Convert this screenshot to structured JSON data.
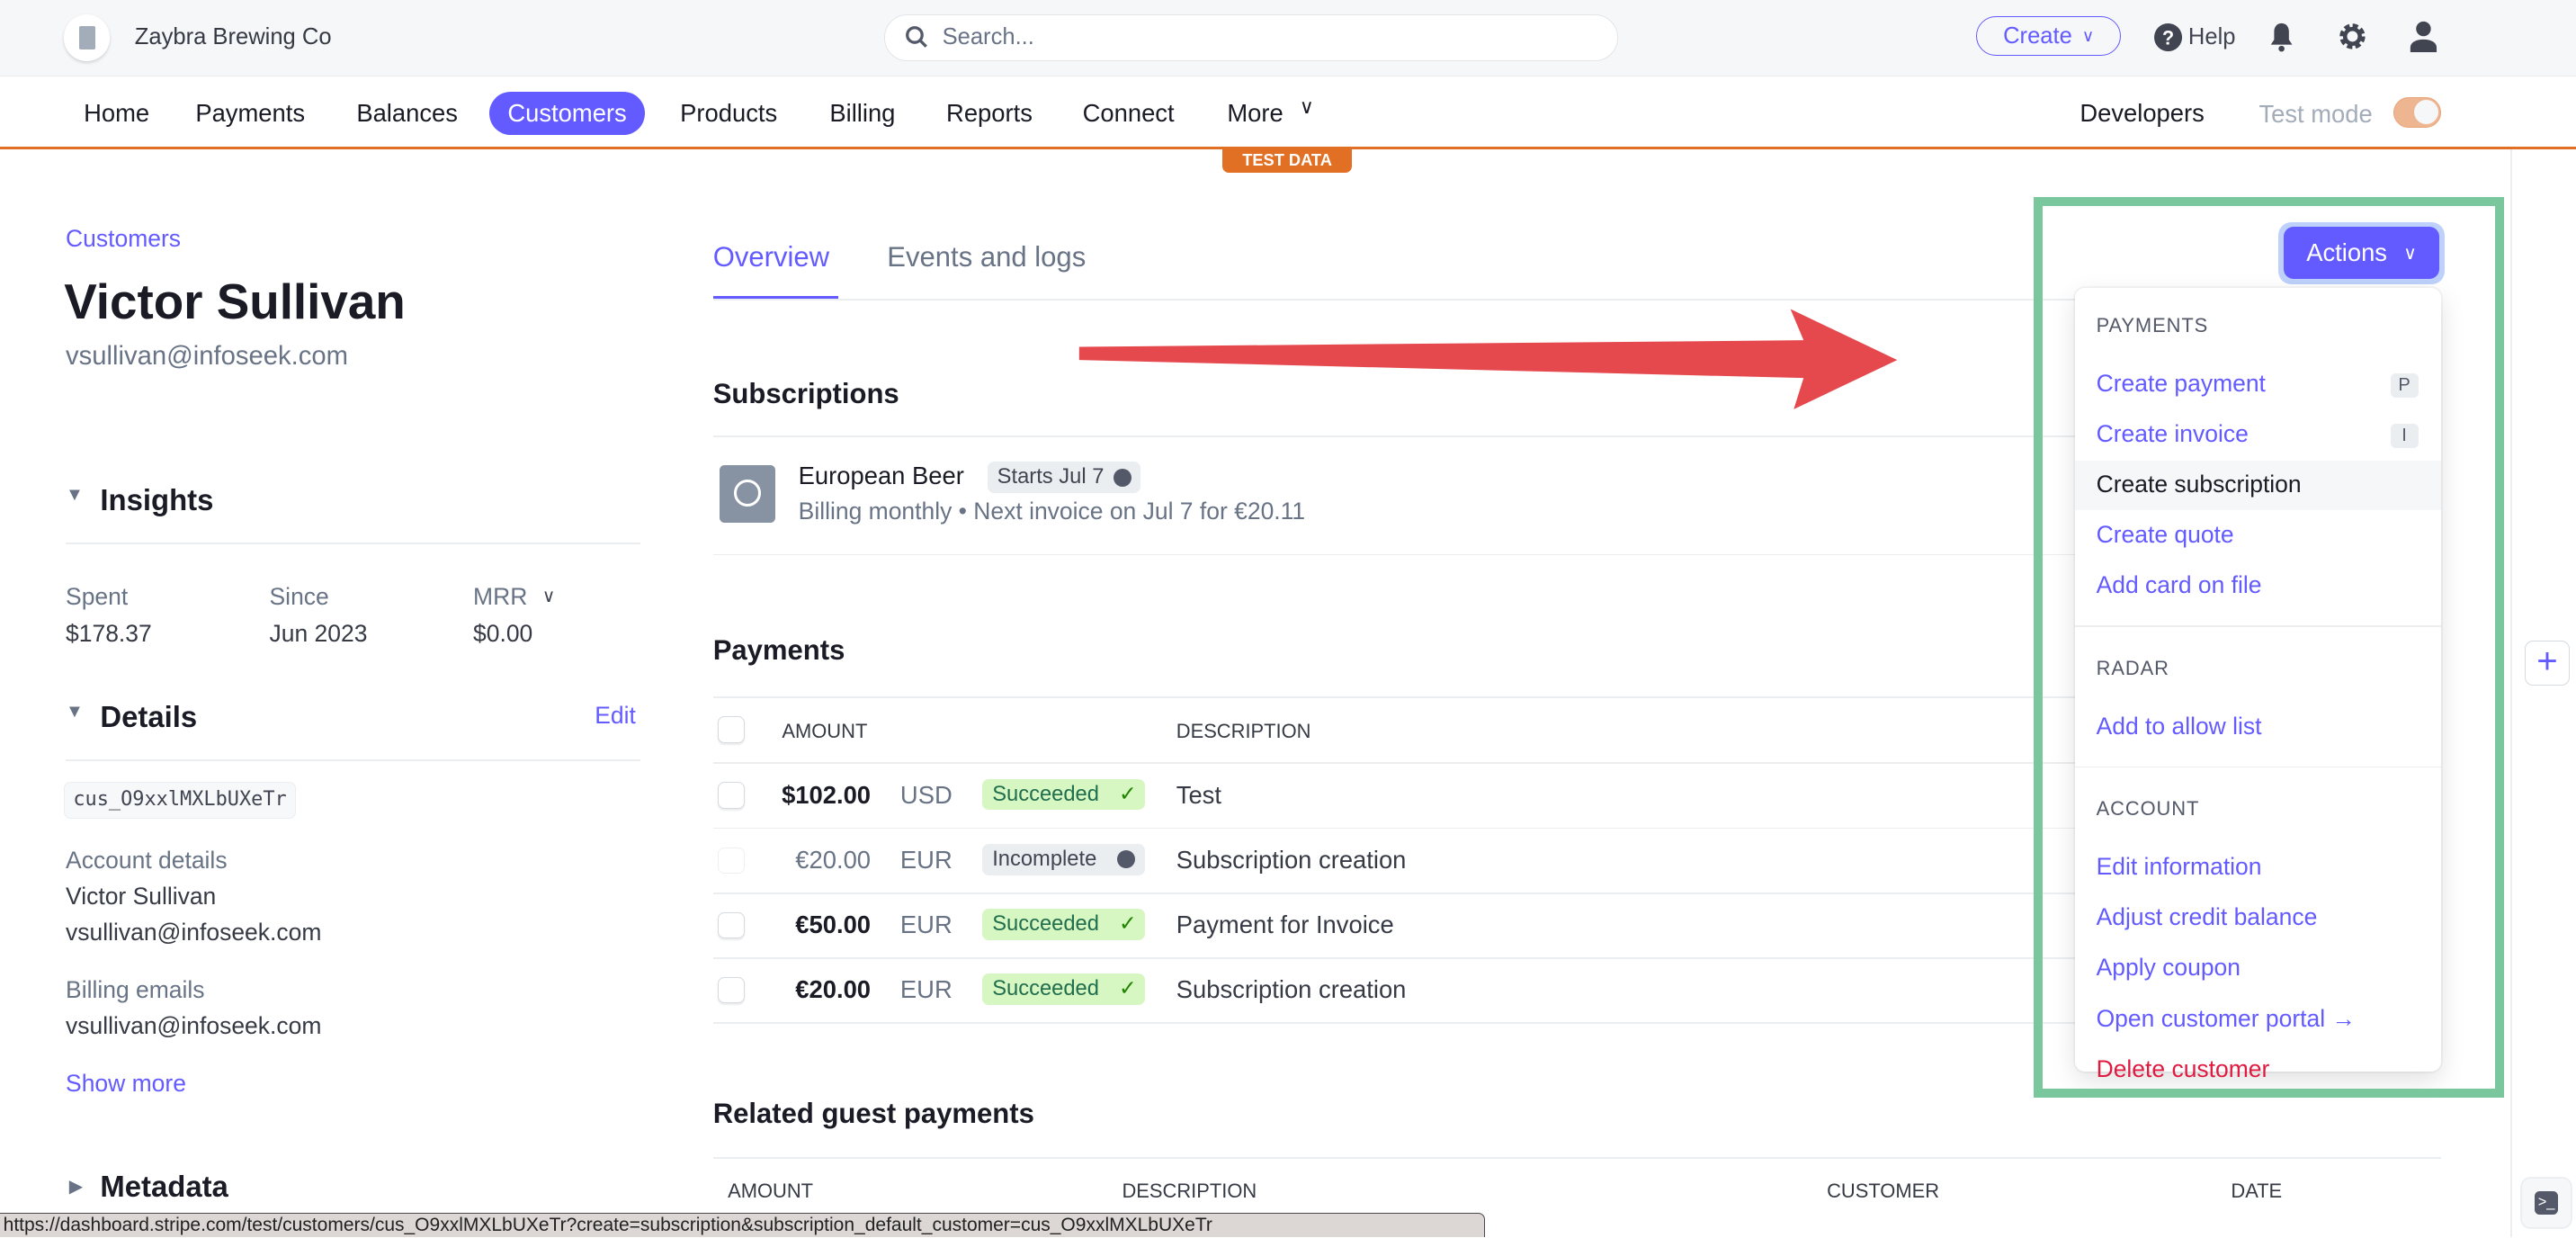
{
  "header": {
    "account_name": "Zaybra Brewing Co",
    "search_placeholder": "Search...",
    "create_label": "Create",
    "help_label": "Help"
  },
  "nav": {
    "items": [
      "Home",
      "Payments",
      "Balances",
      "Customers",
      "Products",
      "Billing",
      "Reports",
      "Connect",
      "More"
    ],
    "active": "Customers",
    "developers": "Developers",
    "test_mode": "Test mode",
    "test_mode_on": true,
    "test_data_badge": "TEST DATA"
  },
  "customer": {
    "breadcrumb": "Customers",
    "name": "Victor Sullivan",
    "email": "vsullivan@infoseek.com"
  },
  "insights": {
    "title": "Insights",
    "spent_label": "Spent",
    "spent": "$178.37",
    "since_label": "Since",
    "since": "Jun 2023",
    "mrr_label": "MRR",
    "mrr": "$0.00"
  },
  "details": {
    "title": "Details",
    "edit": "Edit",
    "id": "cus_O9xxlMXLbUXeTr",
    "account_label": "Account details",
    "account_name": "Victor Sullivan",
    "account_email": "vsullivan@infoseek.com",
    "billing_label": "Billing emails",
    "billing_email": "vsullivan@infoseek.com",
    "show_more": "Show more"
  },
  "metadata": {
    "title": "Metadata"
  },
  "tabs": [
    "Overview",
    "Events and logs"
  ],
  "subscriptions": {
    "title": "Subscriptions",
    "items": [
      {
        "name": "European Beer",
        "badge": "Starts Jul 7",
        "detail": "Billing monthly • Next invoice on Jul 7 for €20.11"
      }
    ]
  },
  "payments": {
    "title": "Payments",
    "columns": [
      "AMOUNT",
      "DESCRIPTION"
    ],
    "rows": [
      {
        "amount": "$102.00",
        "currency": "USD",
        "status": "Succeeded",
        "description": "Test"
      },
      {
        "amount": "€20.00",
        "currency": "EUR",
        "status": "Incomplete",
        "description": "Subscription creation"
      },
      {
        "amount": "€50.00",
        "currency": "EUR",
        "status": "Succeeded",
        "description": "Payment for Invoice"
      },
      {
        "amount": "€20.00",
        "currency": "EUR",
        "status": "Succeeded",
        "description": "Subscription creation"
      }
    ]
  },
  "guest_payments": {
    "title": "Related guest payments",
    "columns": [
      "AMOUNT",
      "DESCRIPTION",
      "CUSTOMER",
      "DATE"
    ]
  },
  "actions": {
    "label": "Actions",
    "sections": [
      {
        "title": "PAYMENTS",
        "items": [
          {
            "label": "Create payment",
            "shortcut": "P"
          },
          {
            "label": "Create invoice",
            "shortcut": "I"
          },
          {
            "label": "Create subscription"
          },
          {
            "label": "Create quote"
          },
          {
            "label": "Add card on file"
          }
        ]
      },
      {
        "title": "RADAR",
        "items": [
          {
            "label": "Add to allow list"
          }
        ]
      },
      {
        "title": "ACCOUNT",
        "items": [
          {
            "label": "Edit information"
          },
          {
            "label": "Adjust credit balance"
          },
          {
            "label": "Apply coupon"
          },
          {
            "label": "Open customer portal"
          },
          {
            "label": "Delete customer"
          }
        ]
      }
    ]
  },
  "status_url": "https://dashboard.stripe.com/test/customers/cus_O9xxlMXLbUXeTr?create=subscription&subscription_default_customer=cus_O9xxlMXLbUXeTr",
  "colors": {
    "accent": "#635bff",
    "test_orange": "#e16f24",
    "success_bg": "#d7f7c2",
    "danger": "#df1b41",
    "annotation_box": "#7ac79d",
    "annotation_arrow": "#e5484d"
  }
}
